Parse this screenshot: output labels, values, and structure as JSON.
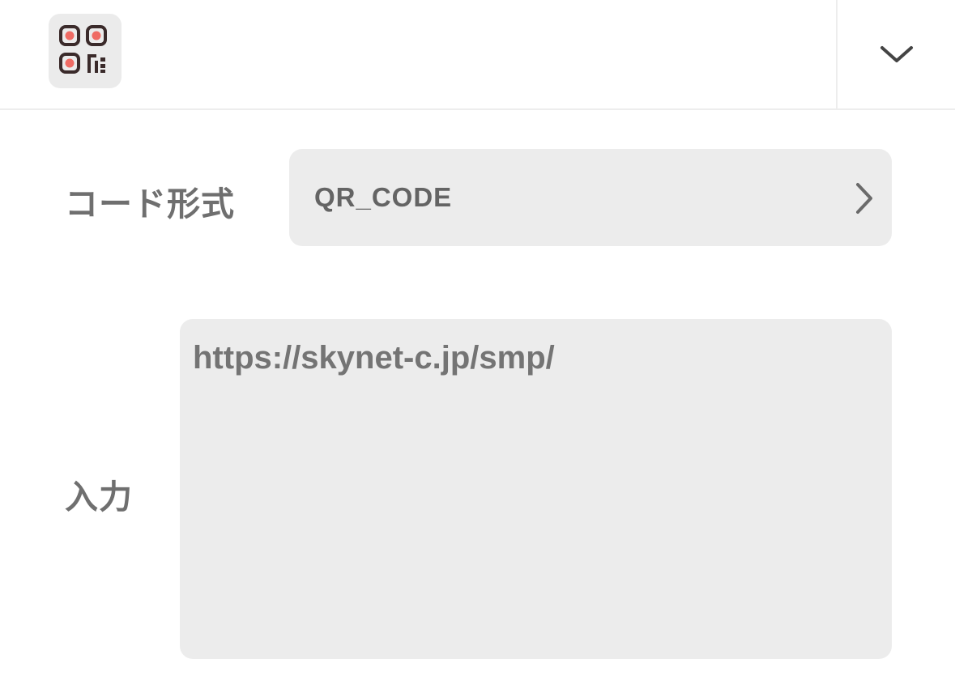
{
  "header": {
    "app_icon": "qr-code-icon",
    "collapse_icon": "chevron-down-icon"
  },
  "form": {
    "format_label": "コード形式",
    "format_value": "QR_CODE",
    "format_chevron_icon": "chevron-right-icon",
    "input_label": "入力",
    "input_value": "https://skynet-c.jp/smp/"
  },
  "colors": {
    "accent": "#ef6b64",
    "icon_dark": "#3a2a2a",
    "field_bg": "#ececec",
    "label_text": "#6f6f6f"
  }
}
